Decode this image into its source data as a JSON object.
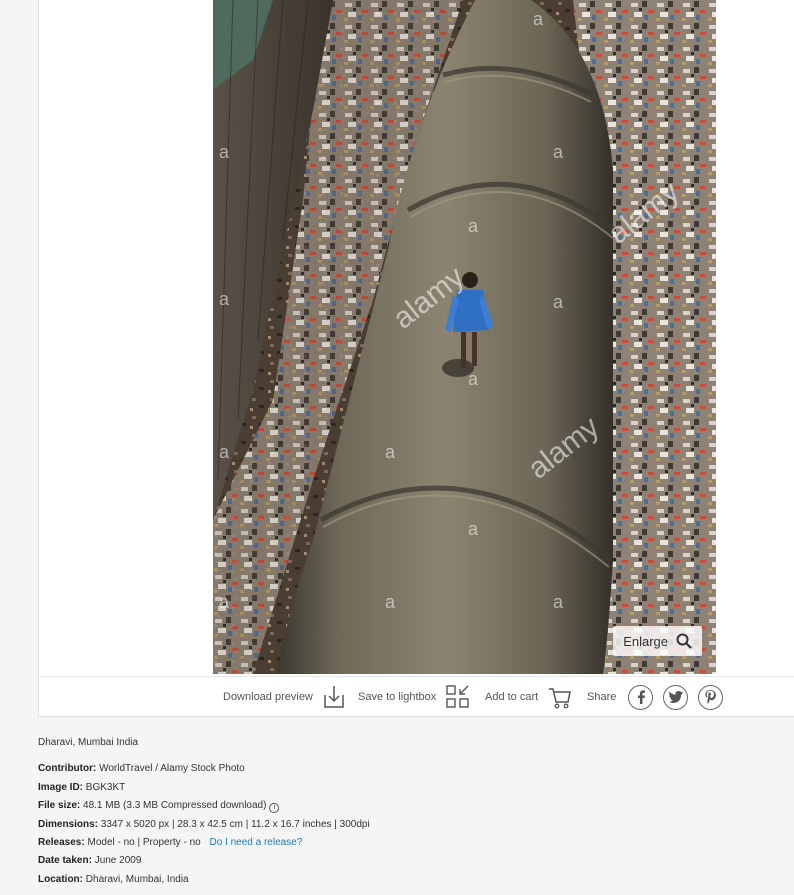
{
  "photo": {
    "alt": "",
    "watermark": "alamy",
    "watermark_small": "a",
    "enlarge_label": "Enlarge"
  },
  "toolbar": {
    "download_label": "Download preview",
    "lightbox_label": "Save to lightbox",
    "cart_label": "Add to cart",
    "share_label": "Share",
    "share_icons": [
      "facebook-icon",
      "twitter-icon",
      "pinterest-icon"
    ]
  },
  "details": {
    "caption": "Dharavi, Mumbai India",
    "contributor_label": "Contributor:",
    "contributor_value": "WorldTravel / Alamy Stock Photo",
    "image_id_label": "Image ID:",
    "image_id_value": "BGK3KT",
    "file_size_label": "File size:",
    "file_size_value": "48.1 MB (3.3 MB Compressed download)",
    "dimensions_label": "Dimensions:",
    "dimensions_value": "3347 x 5020 px | 28.3 x 42.5 cm | 11.2 x 16.7 inches | 300dpi",
    "releases_label": "Releases:",
    "releases_value": "Model - no | Property - no",
    "release_link": "Do I need a release?",
    "date_label": "Date taken:",
    "date_value": "June 2009",
    "location_label": "Location:",
    "location_value": "Dharavi, Mumbai, India"
  },
  "colors": {
    "link": "#1f78b4",
    "pipe": "#77705f",
    "shirt": "#2f6fc4"
  }
}
